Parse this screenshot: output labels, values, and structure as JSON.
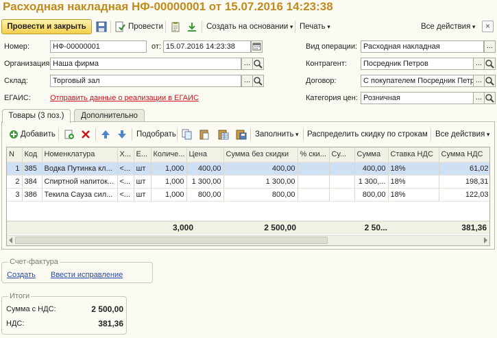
{
  "title": "Расходная накладная НФ-00000001 от 15.07.2016 14:23:38",
  "toolbar": {
    "post_and_close": "Провести и закрыть",
    "post": "Провести",
    "create_based_on": "Создать на основании",
    "print": "Печать",
    "all_actions": "Все действия",
    "close": "×"
  },
  "fields": {
    "number_label": "Номер:",
    "number_value": "НФ-00000001",
    "date_label": "от:",
    "date_value": "15.07.2016 14:23:38",
    "org_label": "Организация:",
    "org_value": "Наша фирма",
    "warehouse_label": "Склад:",
    "warehouse_value": "Торговый зал",
    "egais_label": "ЕГАИС:",
    "egais_link": "Отправить данные о реализации в ЕГАИС",
    "operation_label": "Вид операции:",
    "operation_value": "Расходная накладная",
    "counterparty_label": "Контрагент:",
    "counterparty_value": "Посредник Петров",
    "contract_label": "Договор:",
    "contract_value": "С покупателем Посредник Петров",
    "price_cat_label": "Категория цен:",
    "price_cat_value": "Розничная",
    "select_btn": "...",
    "search_btn": "🔍"
  },
  "tabs": [
    {
      "label": "Товары (3 поз.)"
    },
    {
      "label": "Дополнительно"
    }
  ],
  "table_toolbar": {
    "add": "Добавить",
    "pick": "Подобрать",
    "fill": "Заполнить",
    "distribute": "Распределить скидку по строкам",
    "all_actions": "Все действия"
  },
  "table": {
    "columns": [
      "N",
      "Код",
      "Номенклатура",
      "Х...",
      "Е...",
      "Количе...",
      "Цена",
      "Сумма без скидки",
      "% ски...",
      "Су...",
      "Сумма",
      "Ставка НДС",
      "Сумма НДС"
    ],
    "rows": [
      {
        "n": "1",
        "code": "385",
        "name": "Водка Путинка кл...",
        "x": "<...",
        "unit": "шт",
        "qty": "1,000",
        "price": "400,00",
        "sum_nd": "400,00",
        "disc": "",
        "su": "",
        "sum": "400,00",
        "vat_rate": "18%",
        "vat": "61,02"
      },
      {
        "n": "2",
        "code": "384",
        "name": "Спиртной напиток...",
        "x": "<...",
        "unit": "шт",
        "qty": "1,000",
        "price": "1 300,00",
        "sum_nd": "1 300,00",
        "disc": "",
        "su": "",
        "sum": "1 300,...",
        "vat_rate": "18%",
        "vat": "198,31"
      },
      {
        "n": "3",
        "code": "386",
        "name": "Текила Сауза сил...",
        "x": "<...",
        "unit": "шт",
        "qty": "1,000",
        "price": "800,00",
        "sum_nd": "800,00",
        "disc": "",
        "su": "",
        "sum": "800,00",
        "vat_rate": "18%",
        "vat": "122,03"
      }
    ],
    "totals": {
      "qty": "3,000",
      "sum_nd": "2 500,00",
      "sum": "2 50...",
      "vat": "381,36"
    }
  },
  "invoice": {
    "title": "Счет-фактура",
    "create": "Создать",
    "correction": "Ввести исправление"
  },
  "totals_group": {
    "title": "Итоги",
    "sum_label": "Сумма с НДС:",
    "sum_value": "2 500,00",
    "vat_label": "НДС:",
    "vat_value": "381,36"
  },
  "colors": {
    "title": "#c08a1d",
    "primary_button": "#f2cf4a",
    "selected_row": "#cfe0f5",
    "egais_link": "#d0121b"
  }
}
